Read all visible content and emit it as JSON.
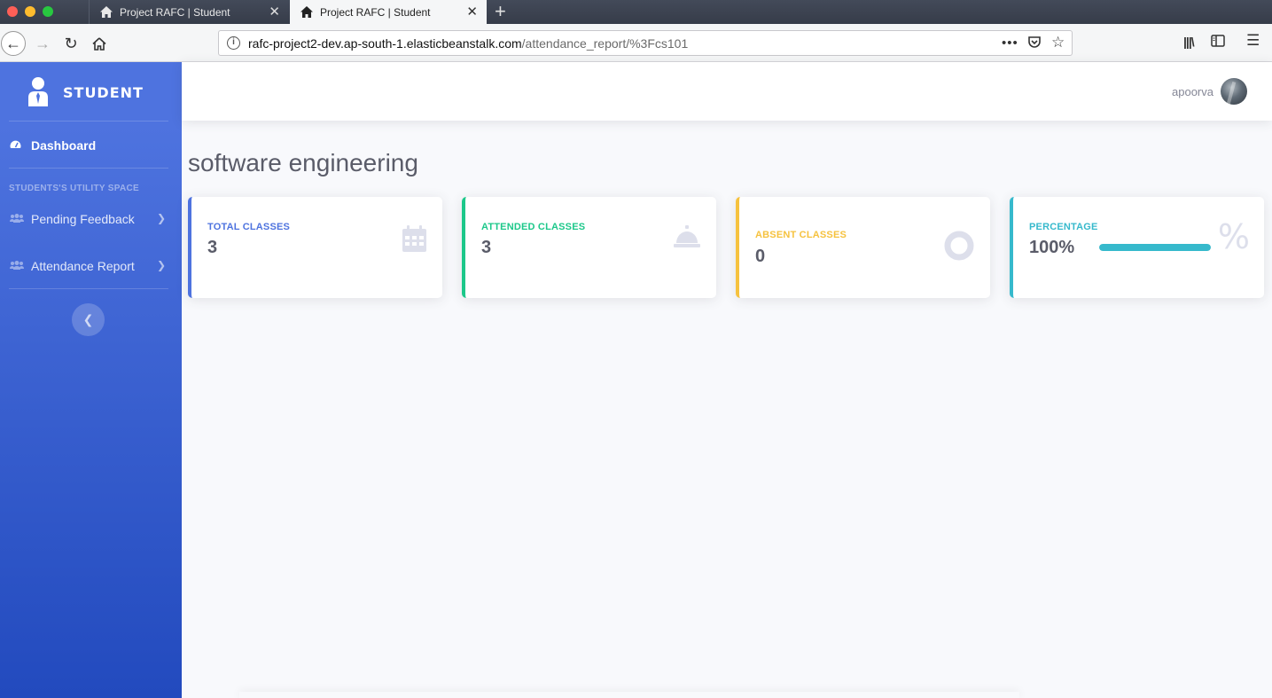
{
  "browser": {
    "tabs": [
      {
        "title": "Project RAFC | Student",
        "active": false
      },
      {
        "title": "Project RAFC | Student",
        "active": true
      }
    ],
    "url_host": "rafc-project2-dev.ap-south-1.elasticbeanstalk.com",
    "url_path": "/attendance_report/%3Fcs101"
  },
  "sidebar": {
    "brand": "STUDENT",
    "dashboard": "Dashboard",
    "heading": "STUDENTS'S UTILITY SPACE",
    "items": [
      {
        "label": "Pending Feedback"
      },
      {
        "label": "Attendance Report"
      }
    ]
  },
  "topbar": {
    "username": "apoorva"
  },
  "main": {
    "title": "software engineering",
    "cards": [
      {
        "label": "TOTAL CLASSES",
        "value": "3",
        "icon": "calendar-icon",
        "color": "#4e73df"
      },
      {
        "label": "ATTENDED CLASSES",
        "value": "3",
        "icon": "bell-icon",
        "color": "#1cc88a"
      },
      {
        "label": "ABSENT CLASSES",
        "value": "0",
        "icon": "circle-icon",
        "color": "#f6c23e"
      },
      {
        "label": "PERCENTAGE",
        "value": "100%",
        "icon": "percent-icon",
        "color": "#36b9cc",
        "progress_percent": 100
      }
    ]
  }
}
